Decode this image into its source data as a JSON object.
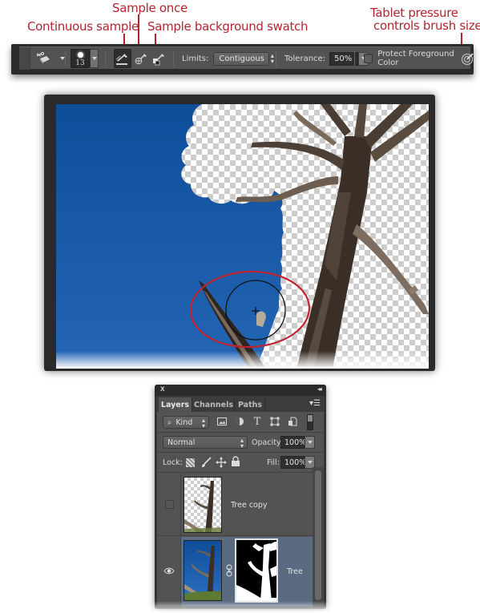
{
  "callouts": {
    "continuous_sample": "Continuous sample",
    "sample_once": "Sample once",
    "sample_background_swatch": "Sample background swatch",
    "tablet_pressure_line1": "Tablet pressure",
    "tablet_pressure_line2": "controls brush size",
    "color": "#b1252f"
  },
  "options_bar": {
    "tool_icon": "background-eraser-icon",
    "brush_size": "13",
    "sampling_modes": [
      {
        "name": "continuous",
        "icon": "eyedropper-continuous-icon",
        "active": true
      },
      {
        "name": "once",
        "icon": "eyedropper-once-icon",
        "active": false
      },
      {
        "name": "background-swatch",
        "icon": "eyedropper-swatch-icon",
        "active": false
      }
    ],
    "limits_label": "Limits:",
    "limits_value": "Contiguous",
    "tolerance_label": "Tolerance:",
    "tolerance_value": "50%",
    "protect_fg_label": "Protect Foreground Color",
    "protect_fg_checked": false,
    "tablet_pressure_icon": "tablet-pressure-icon"
  },
  "canvas": {
    "sky_color": "#1c5aa6",
    "annotation_color": "#c0232e",
    "cursor": "brush-circle-with-crosshair"
  },
  "layers_panel": {
    "close_glyph": "x",
    "collapse_glyph": "◂◂",
    "tabs": [
      {
        "label": "Layers",
        "active": true
      },
      {
        "label": "Channels",
        "active": false
      },
      {
        "label": "Paths",
        "active": false
      }
    ],
    "filter": {
      "kind_label": "Kind",
      "icons": [
        "pixel-layer-filter-icon",
        "adjustment-layer-filter-icon",
        "type-layer-filter-icon",
        "shape-layer-filter-icon",
        "smart-object-filter-icon"
      ],
      "type_glyph": "T"
    },
    "blend_mode": "Normal",
    "opacity_label": "Opacity:",
    "opacity_value": "100%",
    "lock_label": "Lock:",
    "fill_label": "Fill:",
    "fill_value": "100%",
    "layers": [
      {
        "name": "Tree copy",
        "visible": false,
        "selected": false,
        "has_mask": false
      },
      {
        "name": "Tree",
        "visible": true,
        "selected": true,
        "has_mask": true
      }
    ]
  }
}
